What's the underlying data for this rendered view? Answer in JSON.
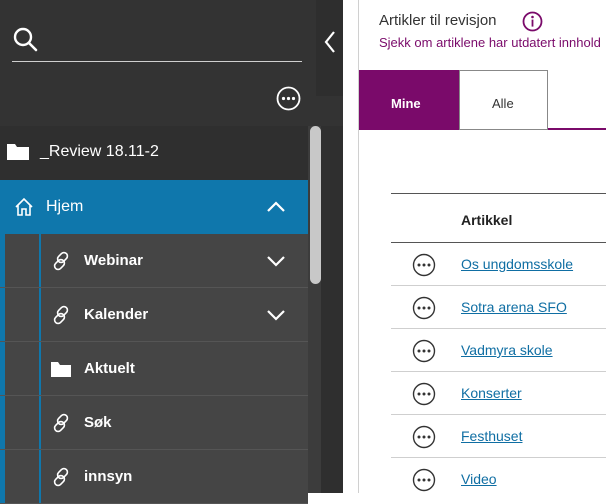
{
  "search": {
    "placeholder": ""
  },
  "tree": {
    "root_label": "_Review 18.11-2",
    "home_label": "Hjem",
    "children": [
      {
        "label": "Webinar",
        "icon": "link-icon",
        "expandable": true
      },
      {
        "label": "Kalender",
        "icon": "link-icon",
        "expandable": true
      },
      {
        "label": "Aktuelt",
        "icon": "folder-icon",
        "expandable": false
      },
      {
        "label": "Søk",
        "icon": "link-icon",
        "expandable": false
      },
      {
        "label": "innsyn",
        "icon": "link-icon",
        "expandable": false
      }
    ]
  },
  "panel": {
    "title": "Artikler til revisjon",
    "subtitle": "Sjekk om artiklene har utdatert innhold",
    "tabs": [
      {
        "label": "Mine",
        "active": true
      },
      {
        "label": "Alle",
        "active": false
      }
    ],
    "table_header": "Artikkel",
    "rows": [
      {
        "title": "Os ungdomsskole"
      },
      {
        "title": "Sotra arena SFO"
      },
      {
        "title": "Vadmyra skole"
      },
      {
        "title": "Konserter"
      },
      {
        "title": "Festhuset"
      },
      {
        "title": "Video"
      }
    ]
  },
  "colors": {
    "accent_blue": "#0f77ac",
    "accent_purple": "#7a0a6a",
    "sidebar_bg": "#2f2f2f",
    "link": "#0f6ea3"
  }
}
